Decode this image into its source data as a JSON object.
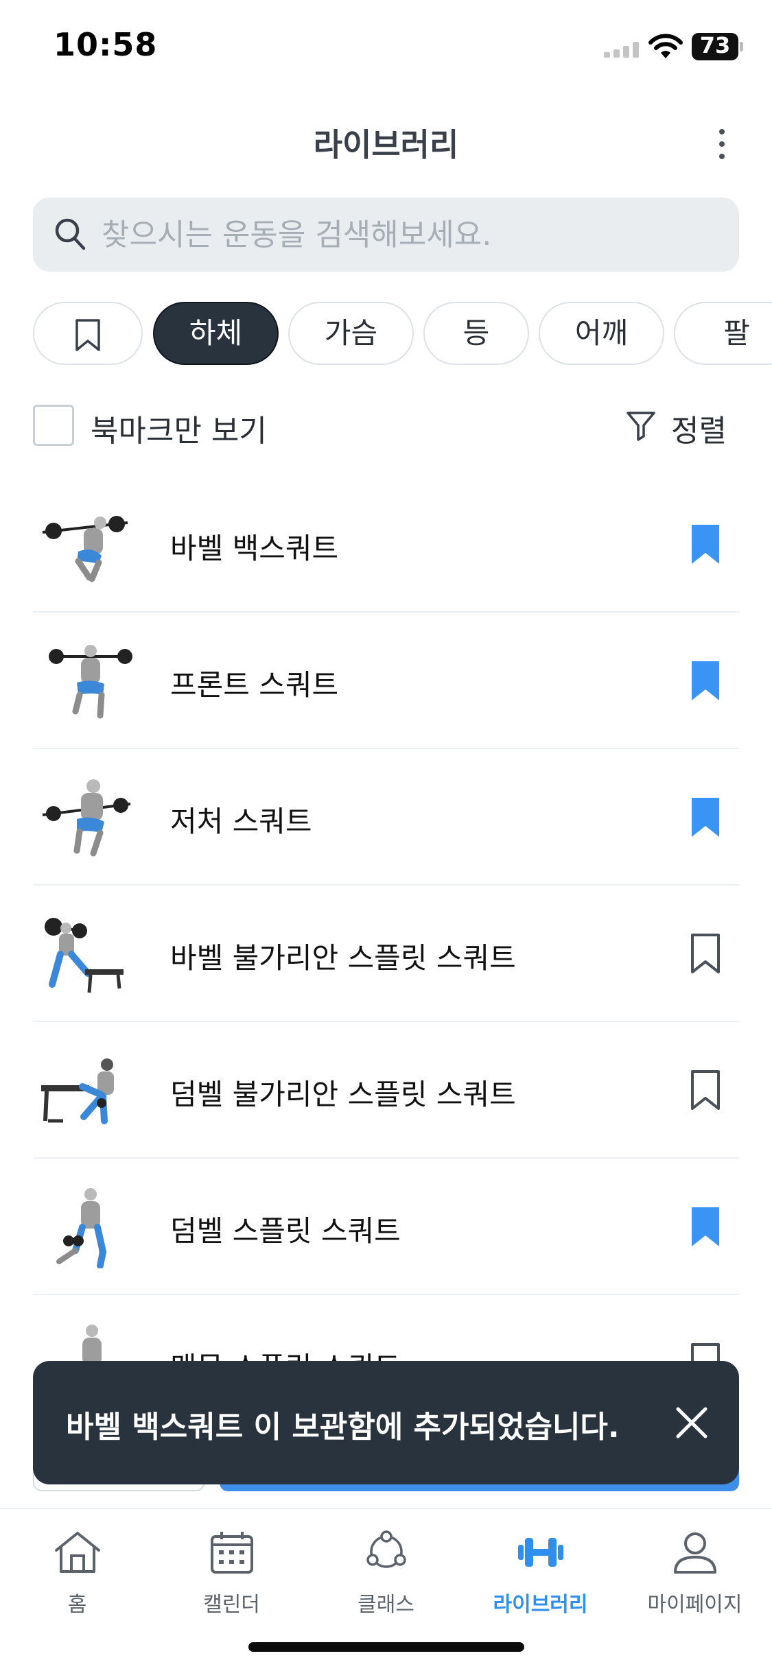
{
  "status_bar": {
    "time": "10:58",
    "battery": "73"
  },
  "header": {
    "title": "라이브러리",
    "more_icon": "more-vertical-icon"
  },
  "search": {
    "placeholder": "찾으시는 운동을 검색해보세요.",
    "value": ""
  },
  "categories": {
    "bookmark_icon": "bookmark-icon",
    "items": [
      {
        "label": "하체",
        "active": true
      },
      {
        "label": "가슴",
        "active": false
      },
      {
        "label": "등",
        "active": false
      },
      {
        "label": "어깨",
        "active": false
      },
      {
        "label": "팔",
        "active": false
      }
    ]
  },
  "filter": {
    "bookmark_only_label": "북마크만 보기",
    "bookmark_only_checked": false,
    "sort_label": "정렬",
    "sort_icon": "filter-icon"
  },
  "exercises": [
    {
      "name": "바벨 백스쿼트",
      "bookmarked": true
    },
    {
      "name": "프론트 스쿼트",
      "bookmarked": true
    },
    {
      "name": "저처 스쿼트",
      "bookmarked": true
    },
    {
      "name": "바벨 불가리안 스플릿 스쿼트",
      "bookmarked": false
    },
    {
      "name": "덤벨 불가리안 스플릿 스쿼트",
      "bookmarked": false
    },
    {
      "name": "덤벨 스플릿 스쿼트",
      "bookmarked": true
    },
    {
      "name": "맨몸 스플릿 스쿼트",
      "bookmarked": false
    }
  ],
  "toast": {
    "message": "바벨 백스쿼트 이 보관함에 추가되었습니다.",
    "close_icon": "close-icon"
  },
  "tabbar": {
    "items": [
      {
        "label": "홈",
        "icon": "home-icon",
        "active": false
      },
      {
        "label": "캘린더",
        "icon": "calendar-icon",
        "active": false
      },
      {
        "label": "클래스",
        "icon": "class-icon",
        "active": false
      },
      {
        "label": "라이브러리",
        "icon": "dumbbell-icon",
        "active": true
      },
      {
        "label": "마이페이지",
        "icon": "person-icon",
        "active": false
      }
    ]
  },
  "colors": {
    "accent": "#3d8fea",
    "dark": "#29333e",
    "bookmark_filled": "#3a94f5"
  }
}
